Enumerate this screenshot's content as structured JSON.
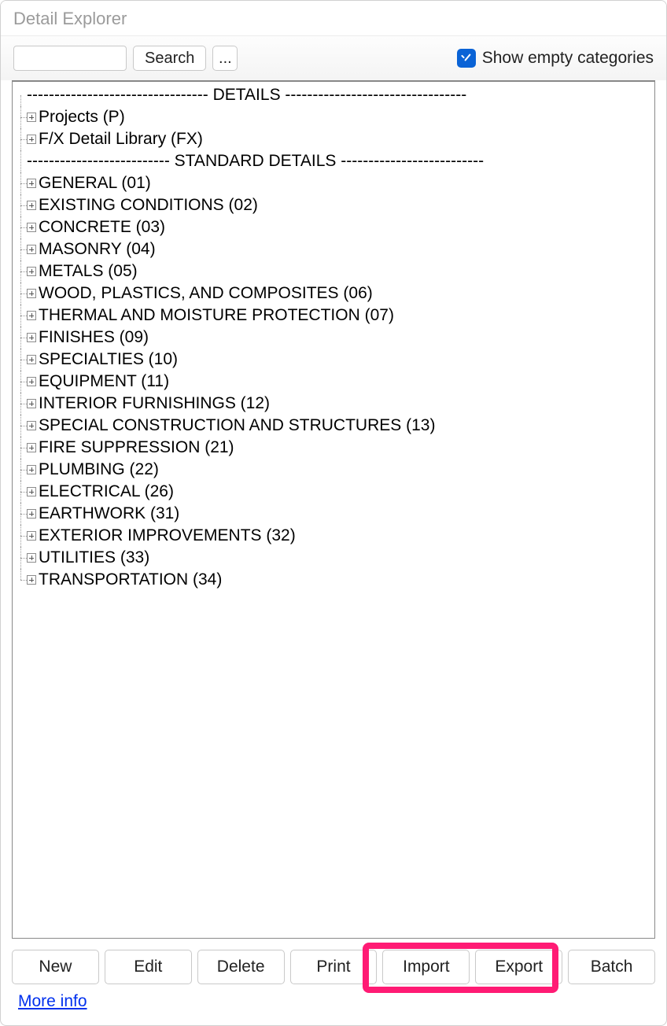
{
  "window": {
    "title": "Detail Explorer"
  },
  "toolbar": {
    "search_value": "",
    "search_button": "Search",
    "ellipsis_button": "...",
    "show_empty_label": "Show empty categories",
    "show_empty_checked": true
  },
  "tree": {
    "heading1": "--------------------------------- DETAILS ---------------------------------",
    "items_top": [
      {
        "label": "Projects (P)"
      },
      {
        "label": "F/X Detail Library (FX)"
      }
    ],
    "heading2": "-------------------------- STANDARD DETAILS --------------------------",
    "items_std": [
      {
        "label": "GENERAL (01)"
      },
      {
        "label": "EXISTING CONDITIONS (02)"
      },
      {
        "label": "CONCRETE (03)"
      },
      {
        "label": "MASONRY (04)"
      },
      {
        "label": "METALS (05)"
      },
      {
        "label": "WOOD, PLASTICS, AND COMPOSITES (06)"
      },
      {
        "label": "THERMAL AND MOISTURE PROTECTION (07)"
      },
      {
        "label": "FINISHES (09)"
      },
      {
        "label": "SPECIALTIES (10)"
      },
      {
        "label": "EQUIPMENT (11)"
      },
      {
        "label": "INTERIOR FURNISHINGS (12)"
      },
      {
        "label": "SPECIAL CONSTRUCTION AND STRUCTURES (13)"
      },
      {
        "label": "FIRE SUPPRESSION (21)"
      },
      {
        "label": "PLUMBING (22)"
      },
      {
        "label": "ELECTRICAL (26)"
      },
      {
        "label": "EARTHWORK (31)"
      },
      {
        "label": "EXTERIOR IMPROVEMENTS (32)"
      },
      {
        "label": "UTILITIES (33)"
      },
      {
        "label": "TRANSPORTATION (34)"
      }
    ]
  },
  "buttons": {
    "new": "New",
    "edit": "Edit",
    "delete": "Delete",
    "print": "Print",
    "import": "Import",
    "export": "Export",
    "batch": "Batch"
  },
  "footer": {
    "more_info": "More info"
  }
}
